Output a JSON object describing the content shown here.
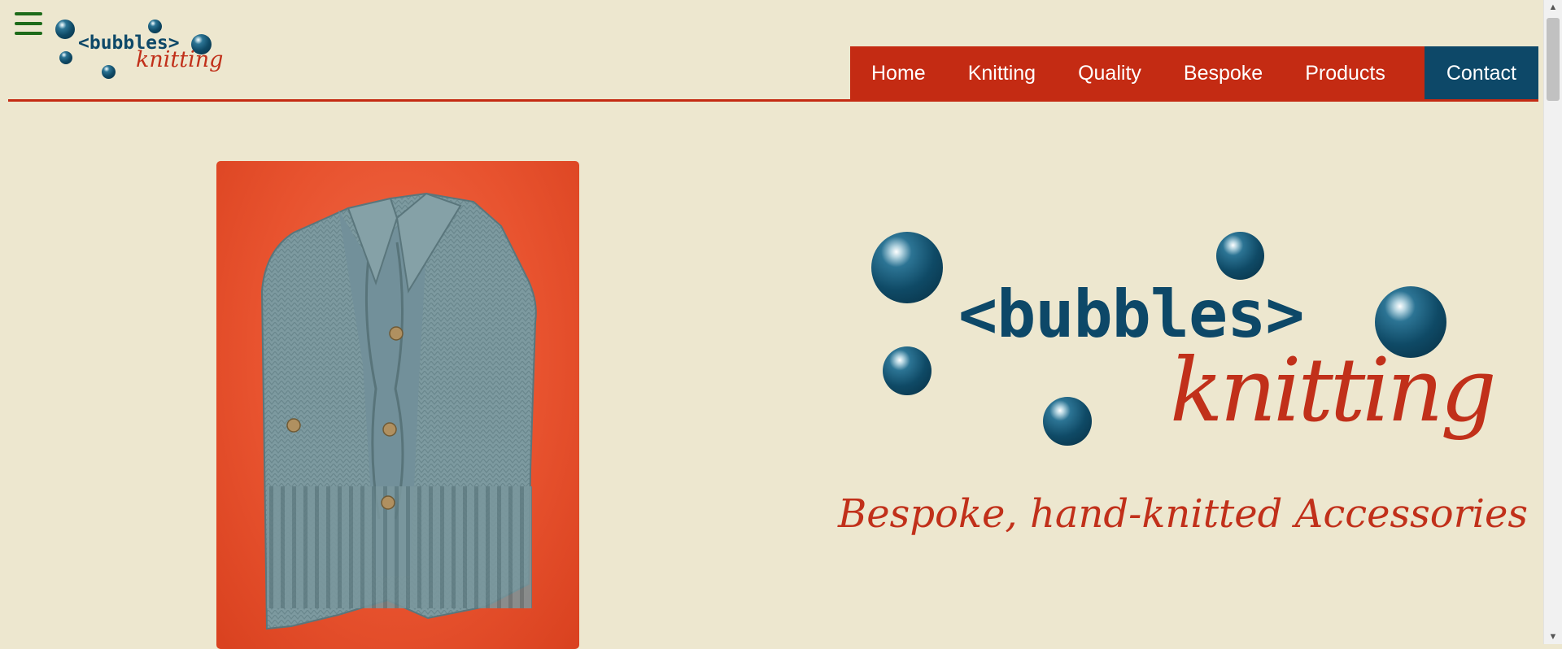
{
  "logo": {
    "word": "<bubbles>",
    "script": "knitting"
  },
  "nav": {
    "items": [
      {
        "label": "Home"
      },
      {
        "label": "Knitting"
      },
      {
        "label": "Quality"
      },
      {
        "label": "Bespoke"
      },
      {
        "label": "Products"
      },
      {
        "label": "Contact"
      }
    ],
    "active": "Contact"
  },
  "hero": {
    "logo_word": "<bubbles>",
    "logo_script": "knitting",
    "tagline": "Bespoke, hand-knitted Accessories"
  },
  "colors": {
    "background": "#ede7cf",
    "nav_red": "#c42b13",
    "nav_active_blue": "#0d4868",
    "bubble_blue": "#0f4a66",
    "script_red": "#c1301a",
    "menu_green": "#1e6b1a"
  },
  "icons": {
    "menu": "hamburger-icon",
    "scroll_up": "chevron-up-icon",
    "scroll_down": "chevron-down-icon"
  }
}
